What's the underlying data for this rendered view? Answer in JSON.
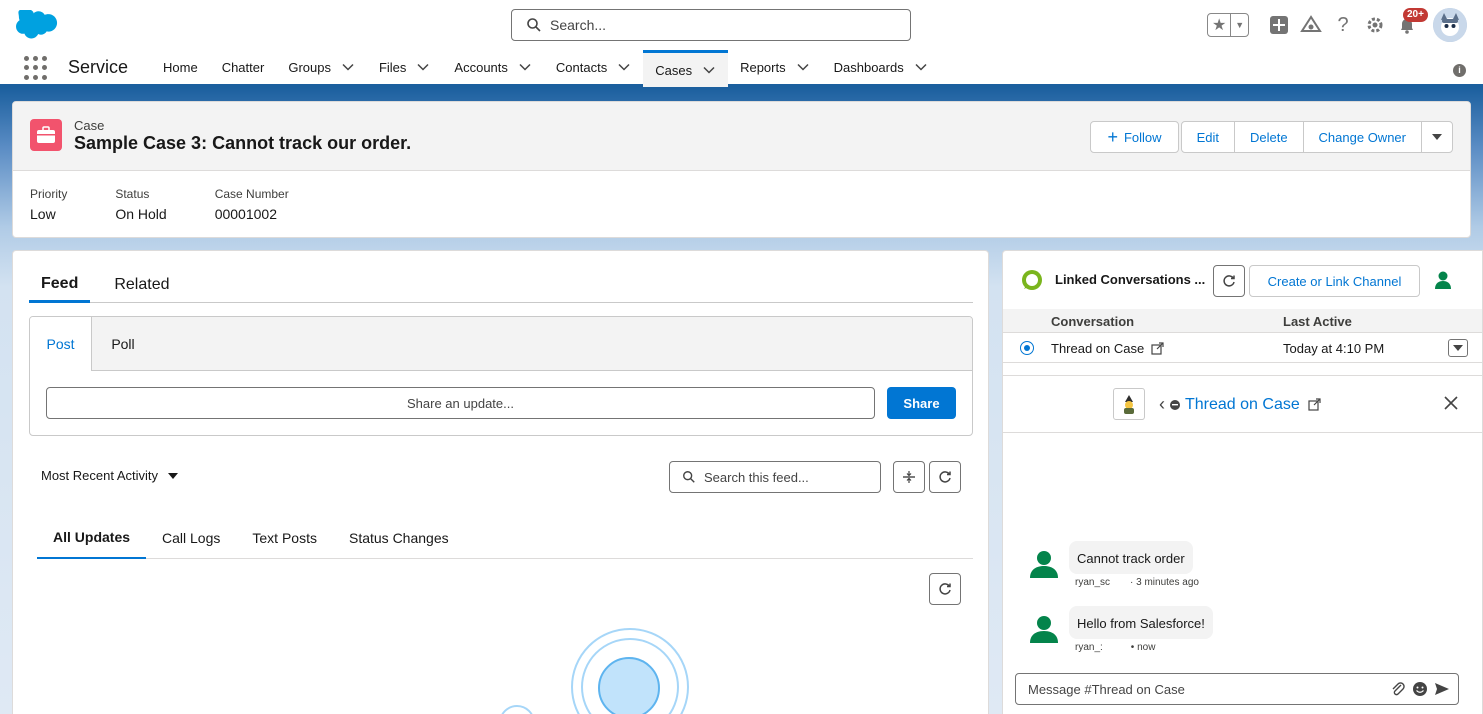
{
  "header": {
    "search_placeholder": "Search...",
    "notification_badge": "20+"
  },
  "nav": {
    "app_name": "Service",
    "items": [
      {
        "label": "Home",
        "has_menu": false,
        "active": false
      },
      {
        "label": "Chatter",
        "has_menu": false,
        "active": false
      },
      {
        "label": "Groups",
        "has_menu": true,
        "active": false
      },
      {
        "label": "Files",
        "has_menu": true,
        "active": false
      },
      {
        "label": "Accounts",
        "has_menu": true,
        "active": false
      },
      {
        "label": "Contacts",
        "has_menu": true,
        "active": false
      },
      {
        "label": "Cases",
        "has_menu": true,
        "active": true
      },
      {
        "label": "Reports",
        "has_menu": true,
        "active": false
      },
      {
        "label": "Dashboards",
        "has_menu": true,
        "active": false
      }
    ]
  },
  "record": {
    "entity_label": "Case",
    "title": "Sample Case 3: Cannot track our order.",
    "actions": {
      "follow": "Follow",
      "edit": "Edit",
      "delete": "Delete",
      "change_owner": "Change Owner"
    },
    "fields": [
      {
        "label": "Priority",
        "value": "Low"
      },
      {
        "label": "Status",
        "value": "On Hold"
      },
      {
        "label": "Case Number",
        "value": "00001002"
      }
    ]
  },
  "feed": {
    "tabs": [
      "Feed",
      "Related"
    ],
    "publisher_tabs": [
      "Post",
      "Poll"
    ],
    "share_placeholder": "Share an update...",
    "share_button": "Share",
    "sort_label": "Most Recent Activity",
    "search_placeholder": "Search this feed...",
    "filter_tabs": [
      "All Updates",
      "Call Logs",
      "Text Posts",
      "Status Changes"
    ]
  },
  "slack": {
    "title": "Linked Conversations ...",
    "link_button": "Create or Link Channel",
    "columns": {
      "conversation": "Conversation",
      "last_active": "Last Active"
    },
    "rows": [
      {
        "conversation": "Thread on Case",
        "last_active": "Today at 4:10 PM"
      }
    ],
    "thread_title": "Thread on Case",
    "messages": [
      {
        "text": "Cannot track order",
        "author": "ryan_sc",
        "time": "· 3 minutes ago"
      },
      {
        "text": "Hello from Salesforce!",
        "author": "ryan_:",
        "time": "• now"
      }
    ],
    "composer_placeholder": "Message #Thread on Case"
  },
  "colors": {
    "brand_blue": "#0176d3",
    "case_icon": "#f2536d",
    "nav_border": "#1b5f9e",
    "avatar_green": "#04844b"
  }
}
